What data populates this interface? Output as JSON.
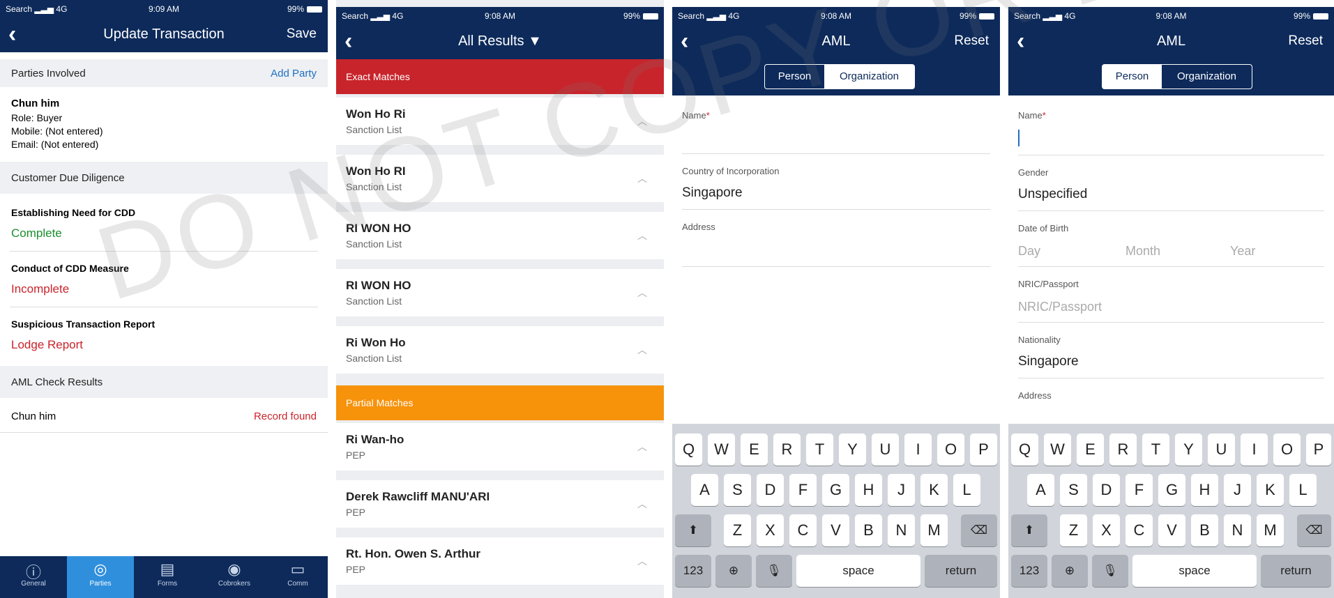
{
  "screens": {
    "s1": {
      "status": {
        "left": "Search",
        "signal": "4G",
        "time": "9:09 AM",
        "battery": "99%"
      },
      "title": "Update Transaction",
      "right": "Save",
      "parties_header": "Parties Involved",
      "add_party": "Add Party",
      "party": {
        "name": "Chun him",
        "role": "Role: Buyer",
        "mobile": "Mobile: (Not entered)",
        "email": "Email: (Not entered)"
      },
      "cdd_header": "Customer Due Diligence",
      "cdd_items": [
        {
          "label": "Establishing Need for CDD",
          "value": "Complete"
        },
        {
          "label": "Conduct of CDD Measure",
          "value": "Incomplete"
        },
        {
          "label": "Suspicious Transaction Report",
          "value": "Lodge Report"
        }
      ],
      "aml_header": "AML Check Results",
      "aml_row": {
        "name": "Chun him",
        "result": "Record found"
      },
      "tabs": [
        "General",
        "Parties",
        "Forms",
        "Cobrokers",
        "Comm"
      ]
    },
    "s2": {
      "status": {
        "left": "Search",
        "signal": "4G",
        "time": "9:08 AM",
        "battery": "99%"
      },
      "title": "All Results",
      "exact_header": "Exact Matches",
      "exact": [
        {
          "name": "Won Ho Ri",
          "list": "Sanction List"
        },
        {
          "name": "Won Ho RI",
          "list": "Sanction List"
        },
        {
          "name": "RI WON HO",
          "list": "Sanction List"
        },
        {
          "name": "RI WON HO",
          "list": "Sanction List"
        },
        {
          "name": "Ri Won Ho",
          "list": "Sanction List"
        }
      ],
      "partial_header": "Partial Matches",
      "partial": [
        {
          "name": "Ri Wan-ho",
          "list": "PEP"
        },
        {
          "name": "Derek Rawcliff MANU'ARI",
          "list": "PEP"
        },
        {
          "name": "Rt. Hon. Owen S. Arthur",
          "list": "PEP"
        }
      ]
    },
    "s3": {
      "status": {
        "left": "Search",
        "signal": "4G",
        "time": "9:08 AM",
        "battery": "99%"
      },
      "title": "AML",
      "right": "Reset",
      "seg": [
        "Person",
        "Organization"
      ],
      "name_label": "Name",
      "country_label": "Country of Incorporation",
      "country_value": "Singapore",
      "address_label": "Address"
    },
    "s4": {
      "status": {
        "left": "Search",
        "signal": "4G",
        "time": "9:08 AM",
        "battery": "99%"
      },
      "title": "AML",
      "right": "Reset",
      "seg": [
        "Person",
        "Organization"
      ],
      "name_label": "Name",
      "gender_label": "Gender",
      "gender_value": "Unspecified",
      "dob_label": "Date of Birth",
      "dob_placeholders": [
        "Day",
        "Month",
        "Year"
      ],
      "nric_label": "NRIC/Passport",
      "nric_placeholder": "NRIC/Passport",
      "nationality_label": "Nationality",
      "nationality_value": "Singapore",
      "address_label": "Address"
    }
  },
  "keyboard": {
    "row1": [
      "Q",
      "W",
      "E",
      "R",
      "T",
      "Y",
      "U",
      "I",
      "O",
      "P"
    ],
    "row2": [
      "A",
      "S",
      "D",
      "F",
      "G",
      "H",
      "J",
      "K",
      "L"
    ],
    "row3": [
      "Z",
      "X",
      "C",
      "V",
      "B",
      "N",
      "M"
    ],
    "num": "123",
    "space": "space",
    "ret": "return"
  },
  "watermark": "DO NOT COPY OR DISTRIBUTE",
  "colors": {
    "nav": "#0d2a5a",
    "exact": "#c8242b",
    "partial": "#f7920b",
    "complete": "#1a8f2e",
    "incomplete": "#c8242b",
    "link": "#1f6fc4"
  }
}
